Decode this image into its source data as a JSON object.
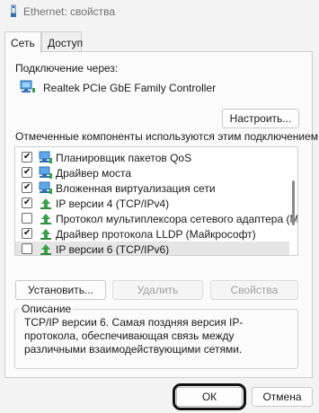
{
  "window": {
    "title": "Ethernet: свойства"
  },
  "tabs": [
    {
      "label": "Сеть",
      "active": true
    },
    {
      "label": "Доступ",
      "active": false
    }
  ],
  "connection": {
    "label": "Подключение через:",
    "adapter_name": "Realtek PCIe GbE Family Controller",
    "configure_button": "Настроить..."
  },
  "components": {
    "label": "Отмеченные компоненты используются этим подключением:",
    "items": [
      {
        "label": "Планировщик пакетов QoS",
        "checked": true,
        "icon": "network-client-icon",
        "selected": false
      },
      {
        "label": "Драйвер моста",
        "checked": true,
        "icon": "network-client-icon",
        "selected": false
      },
      {
        "label": "Вложенная виртуализация сети",
        "checked": true,
        "icon": "network-client-icon",
        "selected": false
      },
      {
        "label": "IP версии 4 (TCP/IPv4)",
        "checked": true,
        "icon": "protocol-icon",
        "selected": false
      },
      {
        "label": "Протокол мультиплексора сетевого адаптера (Ма",
        "checked": false,
        "icon": "protocol-icon",
        "selected": false
      },
      {
        "label": "Драйвер протокола LLDP (Майкрософт)",
        "checked": true,
        "icon": "protocol-icon",
        "selected": false
      },
      {
        "label": "IP версии 6 (TCP/IPv6)",
        "checked": false,
        "icon": "protocol-icon",
        "selected": true
      }
    ]
  },
  "actions": {
    "install": "Установить...",
    "remove": "Удалить",
    "properties": "Свойства"
  },
  "description": {
    "label": "Описание",
    "text": "TCP/IP версии 6. Самая поздняя версия IP-протокола, обеспечивающая связь между различными взаимодействующими сетями."
  },
  "footer": {
    "ok": "ОК",
    "cancel": "Отмена"
  },
  "colors": {
    "monitor_blue": "#2f7fd0",
    "protocol_green": "#3aa04a"
  }
}
